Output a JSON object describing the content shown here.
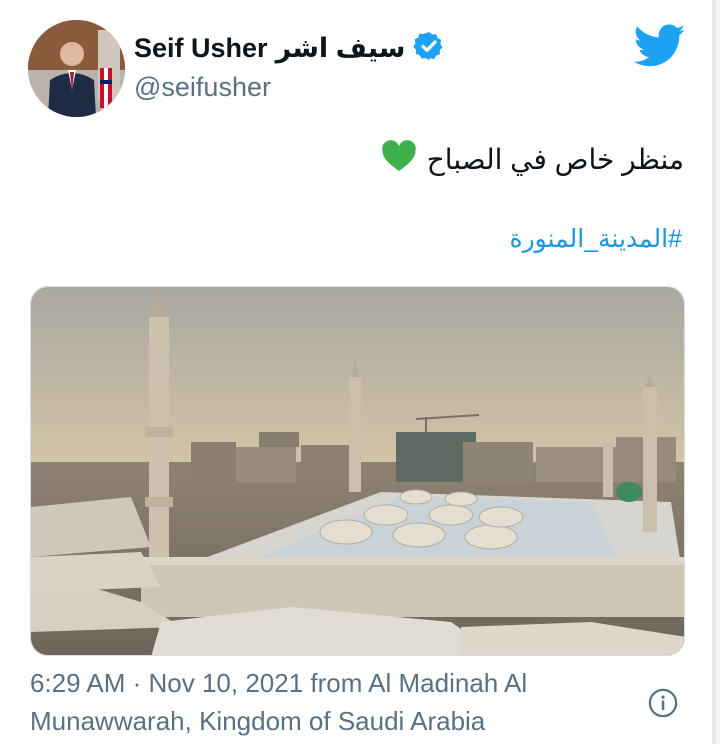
{
  "tweet": {
    "display_name": "Seif Usher",
    "display_name_arabic": "سيف اشر",
    "handle": "@seifusher",
    "verified": true,
    "text": "منظر خاص في الصباح",
    "emoji": "green-heart",
    "hashtag": "#المدينة_المنورة",
    "timestamp_line1": "6:29 AM · Nov 10, 2021 from Al Madinah Al",
    "timestamp_line2": "Munawwarah, Kingdom of Saudi Arabia"
  },
  "icons": {
    "brand": "twitter-bird-icon",
    "verified": "verified-badge-icon",
    "heart": "green-heart-icon",
    "info": "info-icon"
  },
  "colors": {
    "twitter_blue": "#1da1f2",
    "hashtag": "#1b95e0",
    "secondary_text": "#5b7083",
    "heart": "#3eb04b"
  }
}
